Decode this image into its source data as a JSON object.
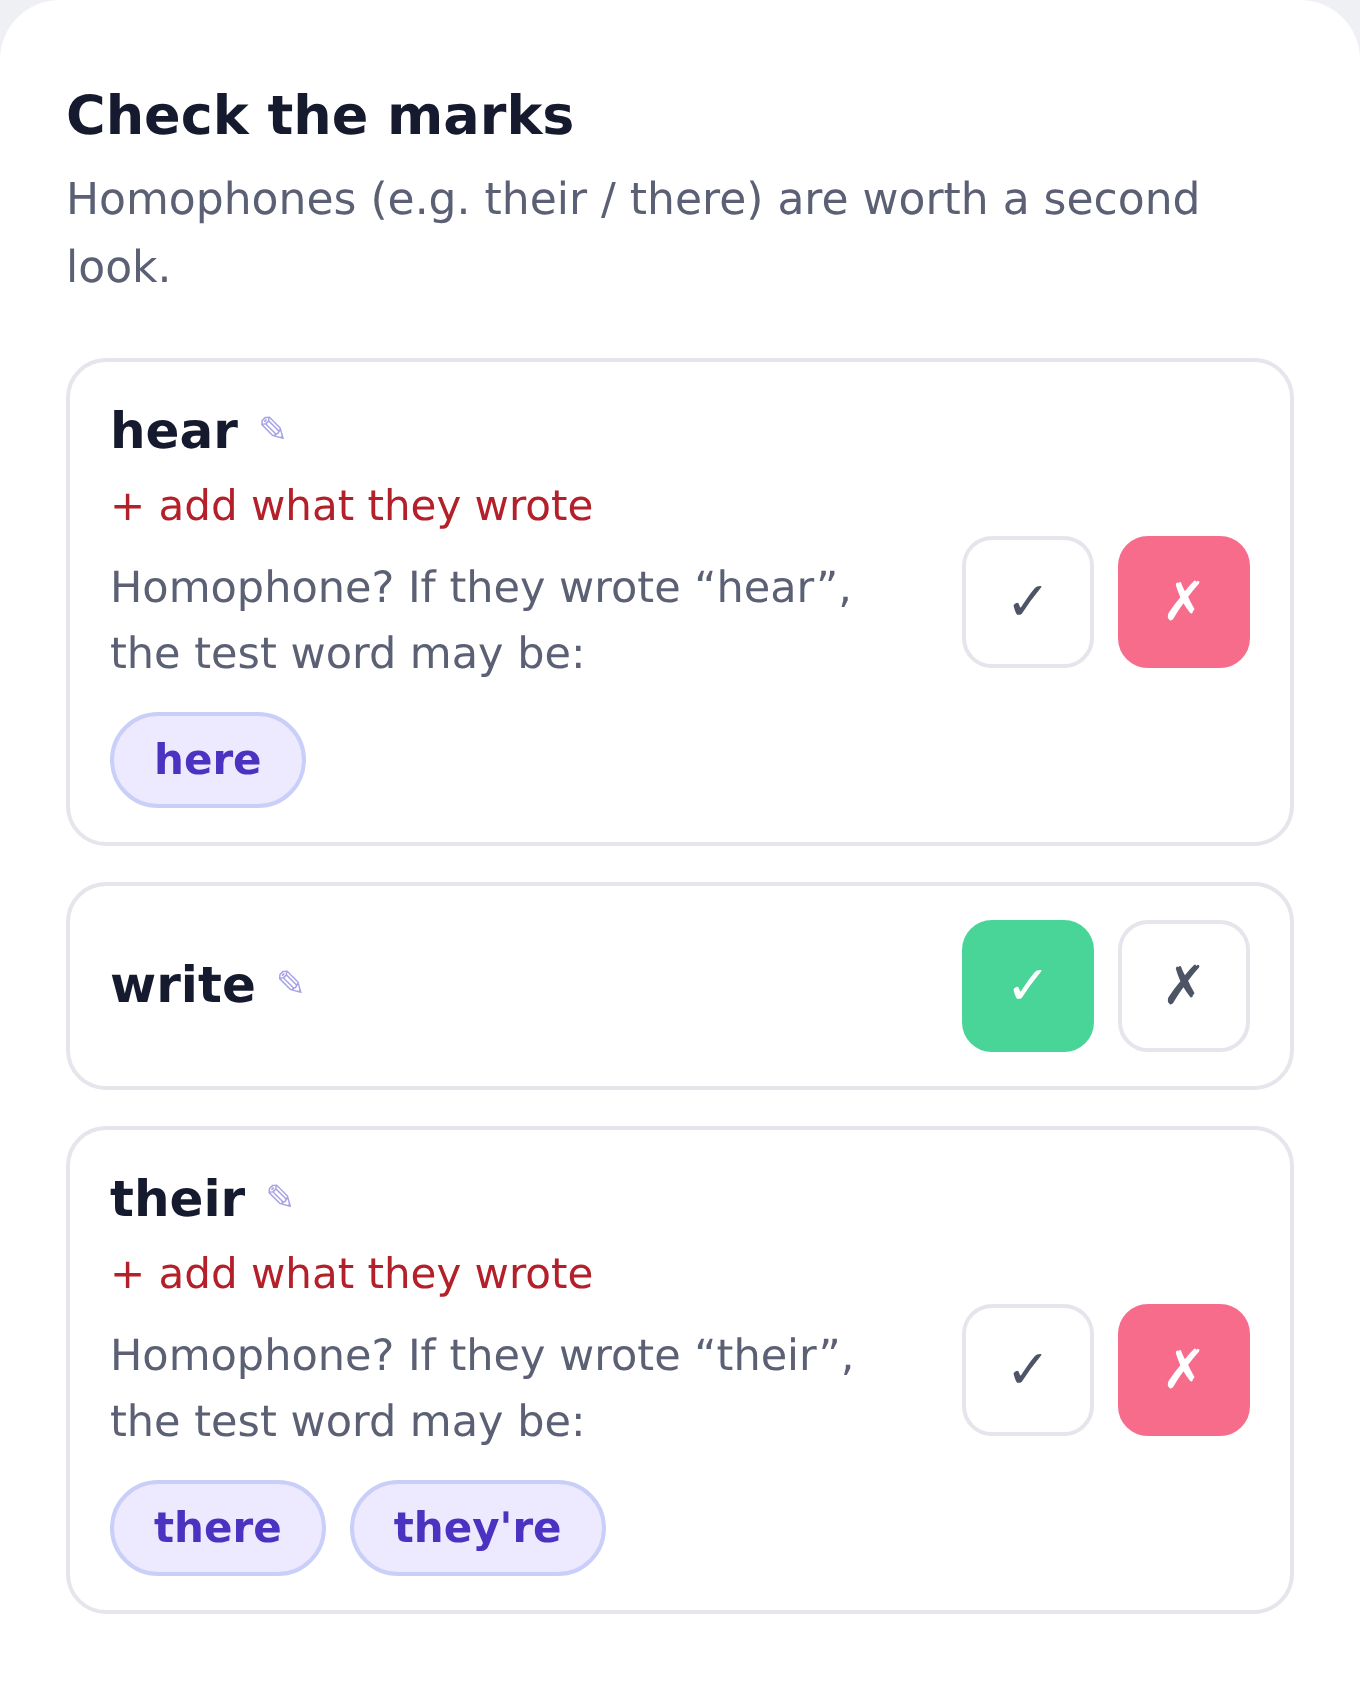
{
  "title": "Check the marks",
  "subtitle": "Homophones (e.g. their / there) are worth a second look.",
  "items": [
    {
      "word": "hear",
      "edit_glyph": "✎",
      "add_link": "+ add what they wrote",
      "hint": "Homophone? If they wrote “hear”, the test word may be:",
      "suggestions": [
        "here"
      ],
      "marks": [
        {
          "kind": "correct",
          "symbol": "✓",
          "selected": false
        },
        {
          "kind": "incorrect",
          "symbol": "✗",
          "selected": true
        }
      ]
    },
    {
      "word": "write",
      "edit_glyph": "✎",
      "marks": [
        {
          "kind": "correct",
          "symbol": "✓",
          "selected": true
        },
        {
          "kind": "incorrect",
          "symbol": "✗",
          "selected": false
        }
      ]
    },
    {
      "word": "their",
      "edit_glyph": "✎",
      "add_link": "+ add what they wrote",
      "hint": "Homophone? If they wrote “their”, the test word may be:",
      "suggestions": [
        "there",
        "they're"
      ],
      "marks": [
        {
          "kind": "correct",
          "symbol": "✓",
          "selected": false
        },
        {
          "kind": "incorrect",
          "symbol": "✗",
          "selected": true
        }
      ]
    }
  ]
}
